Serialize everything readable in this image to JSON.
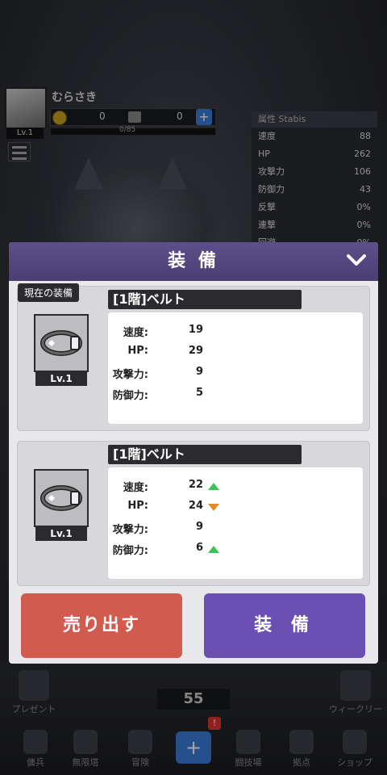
{
  "player": {
    "name": "むらさき",
    "level": "Lv.1",
    "gold": "0",
    "tickets": "0",
    "exp": "0/85",
    "plus": "+"
  },
  "status": {
    "title": "属性 Stabis",
    "rows": [
      {
        "label": "速度",
        "value": "88"
      },
      {
        "label": "HP",
        "value": "262"
      },
      {
        "label": "攻撃力",
        "value": "106"
      },
      {
        "label": "防御力",
        "value": "43"
      },
      {
        "label": "反撃",
        "value": "0%"
      },
      {
        "label": "連撃",
        "value": "0%"
      },
      {
        "label": "回避",
        "value": "0%"
      }
    ]
  },
  "modal": {
    "title": "装 備",
    "current_tag": "現在の装備",
    "current": {
      "name": "[1階]ベルト",
      "level": "Lv.1",
      "stats": [
        {
          "label": "速度:",
          "value": "19"
        },
        {
          "label": "HP:",
          "value": "29"
        },
        {
          "label": "攻撃力:",
          "value": "9"
        },
        {
          "label": "防御力:",
          "value": "5"
        }
      ]
    },
    "candidate": {
      "name": "[1階]ベルト",
      "level": "Lv.1",
      "stats": [
        {
          "label": "速度:",
          "value": "22",
          "trend": "up"
        },
        {
          "label": "HP:",
          "value": "24",
          "trend": "down"
        },
        {
          "label": "攻撃力:",
          "value": "9",
          "trend": "none"
        },
        {
          "label": "防御力:",
          "value": "6",
          "trend": "up"
        }
      ]
    },
    "sell_label": "売り出す",
    "equip_label": "装 備"
  },
  "bottom": {
    "present": "プレゼント",
    "weekly": "ウィークリー",
    "counter": "55",
    "badge": "!",
    "nav": [
      "傭兵",
      "無限塔",
      "冒険",
      "闘技場",
      "拠点",
      "ショップ"
    ]
  },
  "colors": {
    "header_purple": "#5d4f8a",
    "sell_red": "#d25b4f",
    "equip_purple": "#6b4fb3",
    "up_green": "#3cc255",
    "down_orange": "#e08a2a"
  }
}
